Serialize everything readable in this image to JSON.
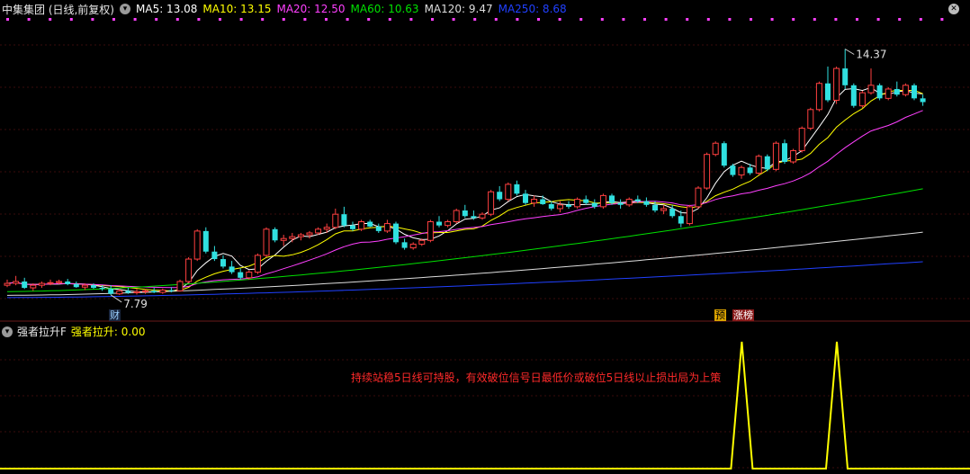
{
  "legend": {
    "title": "中集集团 (日线,前复权)",
    "items": [
      {
        "label": "MA5: 13.08",
        "color": "#ffffff"
      },
      {
        "label": "MA10: 13.15",
        "color": "#ffff00"
      },
      {
        "label": "MA20: 12.50",
        "color": "#ff40ff"
      },
      {
        "label": "MA60: 10.63",
        "color": "#00e000"
      },
      {
        "label": "MA120: 9.47",
        "color": "#dddddd"
      },
      {
        "label": "MA250: 8.68",
        "color": "#2040ff"
      }
    ]
  },
  "sub_legend": {
    "title": "强者拉升F",
    "item": "强者拉升: 0.00",
    "item_color": "#ffff00"
  },
  "note": "持续站稳5日线可持股，有效破位信号日最低价或破位5日线以止损出局为上策",
  "tags": {
    "cai": "财",
    "yu": "预",
    "zhangbang": "涨榜"
  },
  "chart_data": {
    "type": "candlestick",
    "price_range": [
      7.5,
      15.2
    ],
    "high_label": "14.37",
    "low_label": "7.79",
    "candles": [
      [
        8.05,
        8.2,
        8.0,
        8.1
      ],
      [
        8.1,
        8.3,
        8.05,
        8.15
      ],
      [
        8.15,
        8.25,
        7.95,
        7.98
      ],
      [
        7.98,
        8.1,
        7.9,
        8.05
      ],
      [
        8.05,
        8.15,
        7.98,
        8.1
      ],
      [
        8.1,
        8.2,
        8.05,
        8.12
      ],
      [
        8.12,
        8.2,
        8.08,
        8.15
      ],
      [
        8.15,
        8.22,
        8.05,
        8.08
      ],
      [
        8.08,
        8.15,
        7.98,
        8.0
      ],
      [
        8.0,
        8.1,
        7.92,
        8.05
      ],
      [
        8.05,
        8.1,
        7.95,
        7.98
      ],
      [
        7.98,
        8.05,
        7.9,
        7.95
      ],
      [
        7.95,
        8.05,
        7.79,
        7.82
      ],
      [
        7.82,
        7.95,
        7.79,
        7.9
      ],
      [
        7.9,
        7.98,
        7.82,
        7.85
      ],
      [
        7.85,
        7.95,
        7.8,
        7.88
      ],
      [
        7.88,
        7.95,
        7.82,
        7.9
      ],
      [
        7.9,
        7.98,
        7.84,
        7.86
      ],
      [
        7.86,
        7.96,
        7.82,
        7.92
      ],
      [
        7.92,
        8.0,
        7.86,
        7.9
      ],
      [
        7.9,
        8.2,
        7.88,
        8.15
      ],
      [
        8.15,
        8.8,
        8.1,
        8.75
      ],
      [
        8.75,
        9.55,
        8.7,
        9.5
      ],
      [
        9.5,
        9.6,
        8.9,
        8.95
      ],
      [
        8.95,
        9.1,
        8.7,
        8.75
      ],
      [
        8.75,
        8.85,
        8.5,
        8.55
      ],
      [
        8.55,
        8.7,
        8.35,
        8.4
      ],
      [
        8.4,
        8.5,
        8.2,
        8.25
      ],
      [
        8.25,
        8.45,
        8.2,
        8.4
      ],
      [
        8.4,
        8.9,
        8.35,
        8.85
      ],
      [
        8.85,
        9.6,
        8.8,
        9.55
      ],
      [
        9.55,
        9.6,
        9.2,
        9.25
      ],
      [
        9.25,
        9.4,
        9.1,
        9.3
      ],
      [
        9.3,
        9.45,
        9.2,
        9.35
      ],
      [
        9.35,
        9.45,
        9.25,
        9.4
      ],
      [
        9.4,
        9.5,
        9.3,
        9.45
      ],
      [
        9.45,
        9.6,
        9.4,
        9.55
      ],
      [
        9.55,
        9.7,
        9.45,
        9.6
      ],
      [
        9.6,
        10.1,
        9.55,
        9.95
      ],
      [
        9.95,
        10.15,
        9.6,
        9.65
      ],
      [
        9.65,
        9.75,
        9.5,
        9.55
      ],
      [
        9.55,
        9.8,
        9.5,
        9.75
      ],
      [
        9.75,
        9.8,
        9.6,
        9.62
      ],
      [
        9.62,
        9.7,
        9.45,
        9.5
      ],
      [
        9.5,
        9.8,
        9.45,
        9.7
      ],
      [
        9.7,
        9.75,
        9.15,
        9.2
      ],
      [
        9.2,
        9.3,
        9.0,
        9.05
      ],
      [
        9.05,
        9.2,
        9.0,
        9.15
      ],
      [
        9.15,
        9.3,
        9.1,
        9.25
      ],
      [
        9.25,
        9.8,
        9.2,
        9.75
      ],
      [
        9.75,
        9.9,
        9.6,
        9.65
      ],
      [
        9.65,
        9.8,
        9.6,
        9.75
      ],
      [
        9.75,
        10.1,
        9.7,
        10.05
      ],
      [
        10.05,
        10.2,
        9.85,
        9.9
      ],
      [
        9.9,
        10.05,
        9.8,
        9.85
      ],
      [
        9.85,
        10.0,
        9.8,
        9.95
      ],
      [
        9.95,
        10.6,
        9.9,
        10.55
      ],
      [
        10.55,
        10.7,
        10.3,
        10.35
      ],
      [
        10.35,
        10.8,
        10.3,
        10.75
      ],
      [
        10.75,
        10.85,
        10.45,
        10.5
      ],
      [
        10.5,
        10.6,
        10.2,
        10.25
      ],
      [
        10.25,
        10.45,
        10.15,
        10.35
      ],
      [
        10.35,
        10.45,
        10.2,
        10.22
      ],
      [
        10.22,
        10.3,
        10.05,
        10.1
      ],
      [
        10.1,
        10.3,
        10.0,
        10.2
      ],
      [
        10.2,
        10.3,
        10.1,
        10.15
      ],
      [
        10.15,
        10.4,
        10.1,
        10.35
      ],
      [
        10.35,
        10.45,
        10.2,
        10.25
      ],
      [
        10.25,
        10.35,
        10.1,
        10.15
      ],
      [
        10.15,
        10.5,
        10.1,
        10.45
      ],
      [
        10.45,
        10.5,
        10.2,
        10.25
      ],
      [
        10.25,
        10.35,
        10.1,
        10.2
      ],
      [
        10.2,
        10.4,
        10.15,
        10.35
      ],
      [
        10.35,
        10.45,
        10.25,
        10.3
      ],
      [
        10.3,
        10.4,
        10.15,
        10.2
      ],
      [
        10.2,
        10.3,
        10.0,
        10.05
      ],
      [
        10.05,
        10.2,
        9.95,
        10.1
      ],
      [
        10.1,
        10.2,
        9.85,
        9.9
      ],
      [
        9.9,
        10.05,
        9.6,
        9.7
      ],
      [
        9.7,
        10.2,
        9.65,
        10.15
      ],
      [
        10.15,
        10.7,
        10.1,
        10.65
      ],
      [
        10.65,
        11.6,
        10.6,
        11.55
      ],
      [
        11.55,
        11.9,
        11.5,
        11.85
      ],
      [
        11.85,
        11.9,
        11.2,
        11.25
      ],
      [
        11.25,
        11.3,
        10.95,
        11.0
      ],
      [
        11.0,
        11.25,
        10.9,
        11.2
      ],
      [
        11.2,
        11.3,
        11.0,
        11.05
      ],
      [
        11.05,
        11.55,
        11.0,
        11.5
      ],
      [
        11.5,
        11.55,
        11.1,
        11.15
      ],
      [
        11.15,
        11.9,
        11.1,
        11.85
      ],
      [
        11.85,
        11.95,
        11.3,
        11.35
      ],
      [
        11.35,
        11.7,
        11.3,
        11.65
      ],
      [
        11.65,
        12.3,
        11.6,
        12.25
      ],
      [
        12.25,
        12.8,
        12.2,
        12.75
      ],
      [
        12.75,
        13.5,
        12.7,
        13.45
      ],
      [
        13.45,
        13.9,
        12.95,
        13.0
      ],
      [
        13.0,
        13.9,
        12.9,
        13.85
      ],
      [
        13.85,
        14.37,
        13.3,
        13.4
      ],
      [
        13.4,
        13.45,
        12.8,
        12.85
      ],
      [
        12.85,
        13.25,
        12.8,
        13.2
      ],
      [
        13.2,
        13.85,
        13.15,
        13.4
      ],
      [
        13.4,
        13.45,
        13.0,
        13.05
      ],
      [
        13.05,
        13.35,
        13.0,
        13.3
      ],
      [
        13.3,
        13.5,
        13.1,
        13.15
      ],
      [
        13.15,
        13.45,
        13.1,
        13.4
      ],
      [
        13.4,
        13.45,
        13.0,
        13.05
      ],
      [
        13.05,
        13.15,
        12.85,
        12.95
      ]
    ],
    "ma_series": [
      {
        "label": "MA5",
        "color": "#ffffff"
      },
      {
        "label": "MA10",
        "color": "#ffff00"
      },
      {
        "label": "MA20",
        "color": "#ff40ff"
      },
      {
        "label": "MA60",
        "color": "#00e000",
        "y_start": 7.88,
        "y_end": 10.63
      },
      {
        "label": "MA120",
        "color": "#dddddd",
        "y_start": 7.78,
        "y_end": 9.47
      },
      {
        "label": "MA250",
        "color": "#2040ff",
        "y_start": 7.72,
        "y_end": 8.68
      }
    ],
    "signal": {
      "color": "#ffff00",
      "y_range": [
        0,
        1
      ],
      "spikes": [
        84,
        95
      ]
    }
  }
}
